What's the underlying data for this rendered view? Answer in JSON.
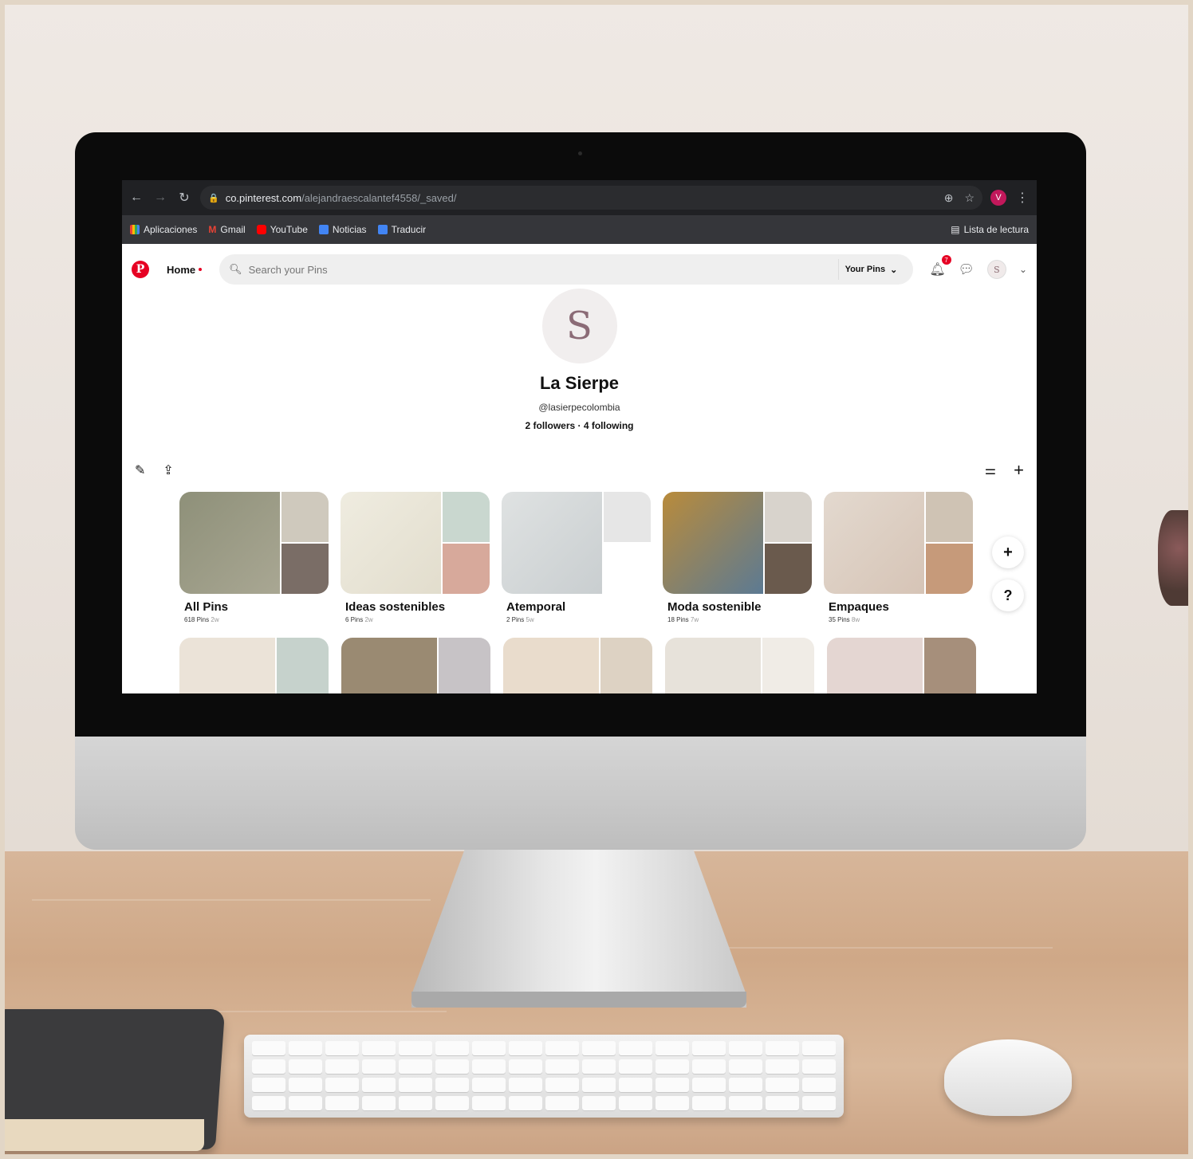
{
  "browser": {
    "url_host": "co.pinterest.com",
    "url_path": "/alejandraescalantef4558/_saved/",
    "profile_initial": "V",
    "bookmarks": [
      {
        "label": "Aplicaciones",
        "icon": "apps-grid-icon",
        "color": "#ea4335"
      },
      {
        "label": "Gmail",
        "icon": "gmail-icon",
        "color": "#ea4335"
      },
      {
        "label": "YouTube",
        "icon": "youtube-icon",
        "color": "#ff0000"
      },
      {
        "label": "Noticias",
        "icon": "news-icon",
        "color": "#4285f4"
      },
      {
        "label": "Traducir",
        "icon": "translate-icon",
        "color": "#4285f4"
      }
    ],
    "reading_list": "Lista de lectura"
  },
  "pinterest": {
    "home_label": "Home",
    "search_placeholder": "Search your Pins",
    "your_pins_label": "Your Pins",
    "notification_count": "7",
    "avatar_letter": "S"
  },
  "profile": {
    "name": "La Sierpe",
    "handle": "@lasierpecolombia",
    "follow_stats": "2 followers · 4 following"
  },
  "boards": [
    {
      "title": "All Pins",
      "count": "618 Pins",
      "age": "2w",
      "colors": [
        "#8e9079",
        "#cfc9bd",
        "#7a6d66"
      ]
    },
    {
      "title": "Ideas sostenibles",
      "count": "6 Pins",
      "age": "2w",
      "colors": [
        "#efece0",
        "#c9d7cf",
        "#d7a99b"
      ]
    },
    {
      "title": "Atemporal",
      "count": "2 Pins",
      "age": "5w",
      "colors": [
        "#dfe2e2",
        "#e6e6e6",
        "#ffffff"
      ]
    },
    {
      "title": "Moda sostenible",
      "count": "18 Pins",
      "age": "7w",
      "colors": [
        "#b98b3b",
        "#d8d3cc",
        "#6a5a4d"
      ]
    },
    {
      "title": "Empaques",
      "count": "35 Pins",
      "age": "8w",
      "colors": [
        "#e3d9cf",
        "#cfc3b4",
        "#c69a7a"
      ]
    }
  ],
  "row2_tiles": [
    [
      "#ebe3d8",
      "#c6d2cc"
    ],
    [
      "#9a8a72",
      "#c7c3c6"
    ],
    [
      "#e9dccc",
      "#ddd2c3"
    ],
    [
      "#e7e2da",
      "#f0ece6"
    ],
    [
      "#e4d6d2",
      "#a68f7b"
    ]
  ],
  "floating": {
    "add_label": "+",
    "help_label": "?"
  },
  "colors": {
    "pinterest_red": "#e60023"
  }
}
